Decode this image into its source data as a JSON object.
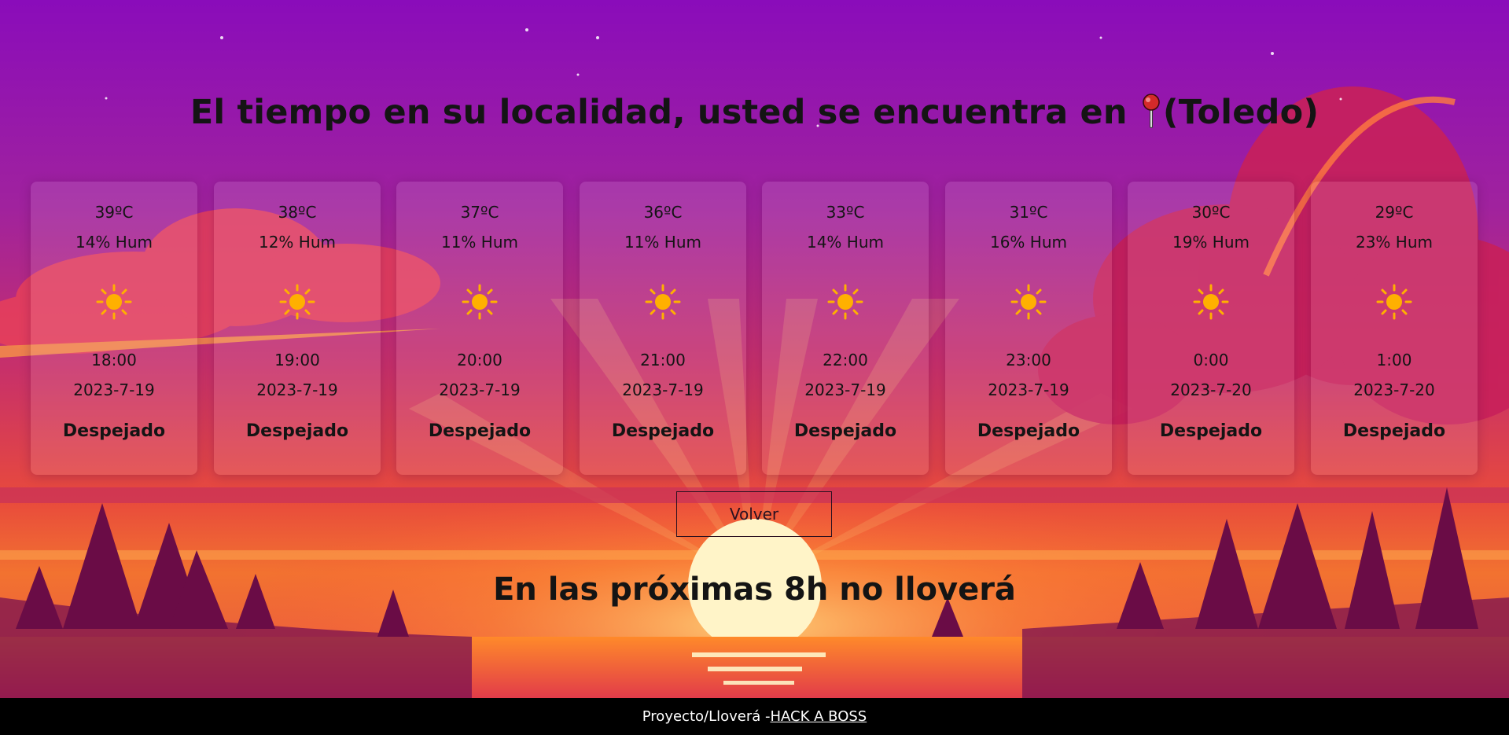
{
  "header": {
    "title": "El tiempo en su localidad, usted se encuentra en",
    "location": "(Toledo)",
    "pin_icon": "round-pushpin-icon"
  },
  "forecast": [
    {
      "temp": "39ºC",
      "humidity": "14% Hum",
      "icon": "sun-icon",
      "time": "18:00",
      "date": "2023-7-19",
      "condition": "Despejado"
    },
    {
      "temp": "38ºC",
      "humidity": "12% Hum",
      "icon": "sun-icon",
      "time": "19:00",
      "date": "2023-7-19",
      "condition": "Despejado"
    },
    {
      "temp": "37ºC",
      "humidity": "11% Hum",
      "icon": "sun-icon",
      "time": "20:00",
      "date": "2023-7-19",
      "condition": "Despejado"
    },
    {
      "temp": "36ºC",
      "humidity": "11% Hum",
      "icon": "sun-icon",
      "time": "21:00",
      "date": "2023-7-19",
      "condition": "Despejado"
    },
    {
      "temp": "33ºC",
      "humidity": "14% Hum",
      "icon": "sun-icon",
      "time": "22:00",
      "date": "2023-7-19",
      "condition": "Despejado"
    },
    {
      "temp": "31ºC",
      "humidity": "16% Hum",
      "icon": "sun-icon",
      "time": "23:00",
      "date": "2023-7-19",
      "condition": "Despejado"
    },
    {
      "temp": "30ºC",
      "humidity": "19% Hum",
      "icon": "sun-icon",
      "time": "0:00",
      "date": "2023-7-20",
      "condition": "Despejado"
    },
    {
      "temp": "29ºC",
      "humidity": "23% Hum",
      "icon": "sun-icon",
      "time": "1:00",
      "date": "2023-7-20",
      "condition": "Despejado"
    }
  ],
  "actions": {
    "back_label": "Volver"
  },
  "message": "En las próximas 8h no lloverá",
  "footer": {
    "text": "Proyecto/Lloverá -",
    "link_label": "HACK A BOSS"
  },
  "colors": {
    "sky_top": "#8a10b8",
    "sunset_orange": "#f25a2a",
    "sun_icon": "#ffb000",
    "footer_bg": "#000000"
  }
}
